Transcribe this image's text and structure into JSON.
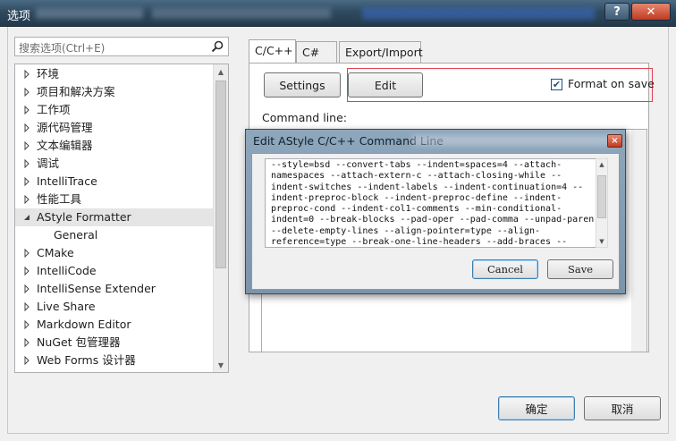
{
  "window": {
    "title": "选项",
    "help_label": "?",
    "close_label": "✕"
  },
  "search": {
    "placeholder": "搜索选项(Ctrl+E)"
  },
  "tree": {
    "items": [
      {
        "label": "环境"
      },
      {
        "label": "项目和解决方案"
      },
      {
        "label": "工作项"
      },
      {
        "label": "源代码管理"
      },
      {
        "label": "文本编辑器"
      },
      {
        "label": "调试"
      },
      {
        "label": "IntelliTrace"
      },
      {
        "label": "性能工具"
      },
      {
        "label": "AStyle Formatter"
      },
      {
        "label": "General"
      },
      {
        "label": "CMake"
      },
      {
        "label": "IntelliCode"
      },
      {
        "label": "IntelliSense Extender"
      },
      {
        "label": "Live Share"
      },
      {
        "label": "Markdown Editor"
      },
      {
        "label": "NuGet 包管理器"
      },
      {
        "label": "Web Forms 设计器"
      }
    ]
  },
  "tabs": {
    "cpp": "C/C++",
    "csharp": "C#",
    "export_import": "Export/Import"
  },
  "panel": {
    "settings_label": "Settings",
    "edit_label": "Edit",
    "format_on_save_label": "Format on save",
    "format_on_save_checked": true,
    "command_line_label": "Command line:"
  },
  "footer": {
    "ok_label": "确定",
    "cancel_label": "取消"
  },
  "modal": {
    "title": "Edit AStyle C/C++ Command Line",
    "close_label": "×",
    "command_text": "--style=bsd --convert-tabs --indent=spaces=4 --attach-\nnamespaces --attach-extern-c --attach-closing-while --\nindent-switches --indent-labels --indent-continuation=4 --\nindent-preproc-block --indent-preproc-define --indent-\npreproc-cond --indent-col1-comments --min-conditional-\nindent=0 --break-blocks --pad-oper --pad-comma --unpad-paren\n--delete-empty-lines --align-pointer=type --align-\nreference=type --break-one-line-headers --add-braces --",
    "cancel_label": "Cancel",
    "save_label": "Save"
  },
  "colors": {
    "accent": "#3c7fb1",
    "highlight_border": "#e04050",
    "titlebar": "#2f4a60"
  }
}
